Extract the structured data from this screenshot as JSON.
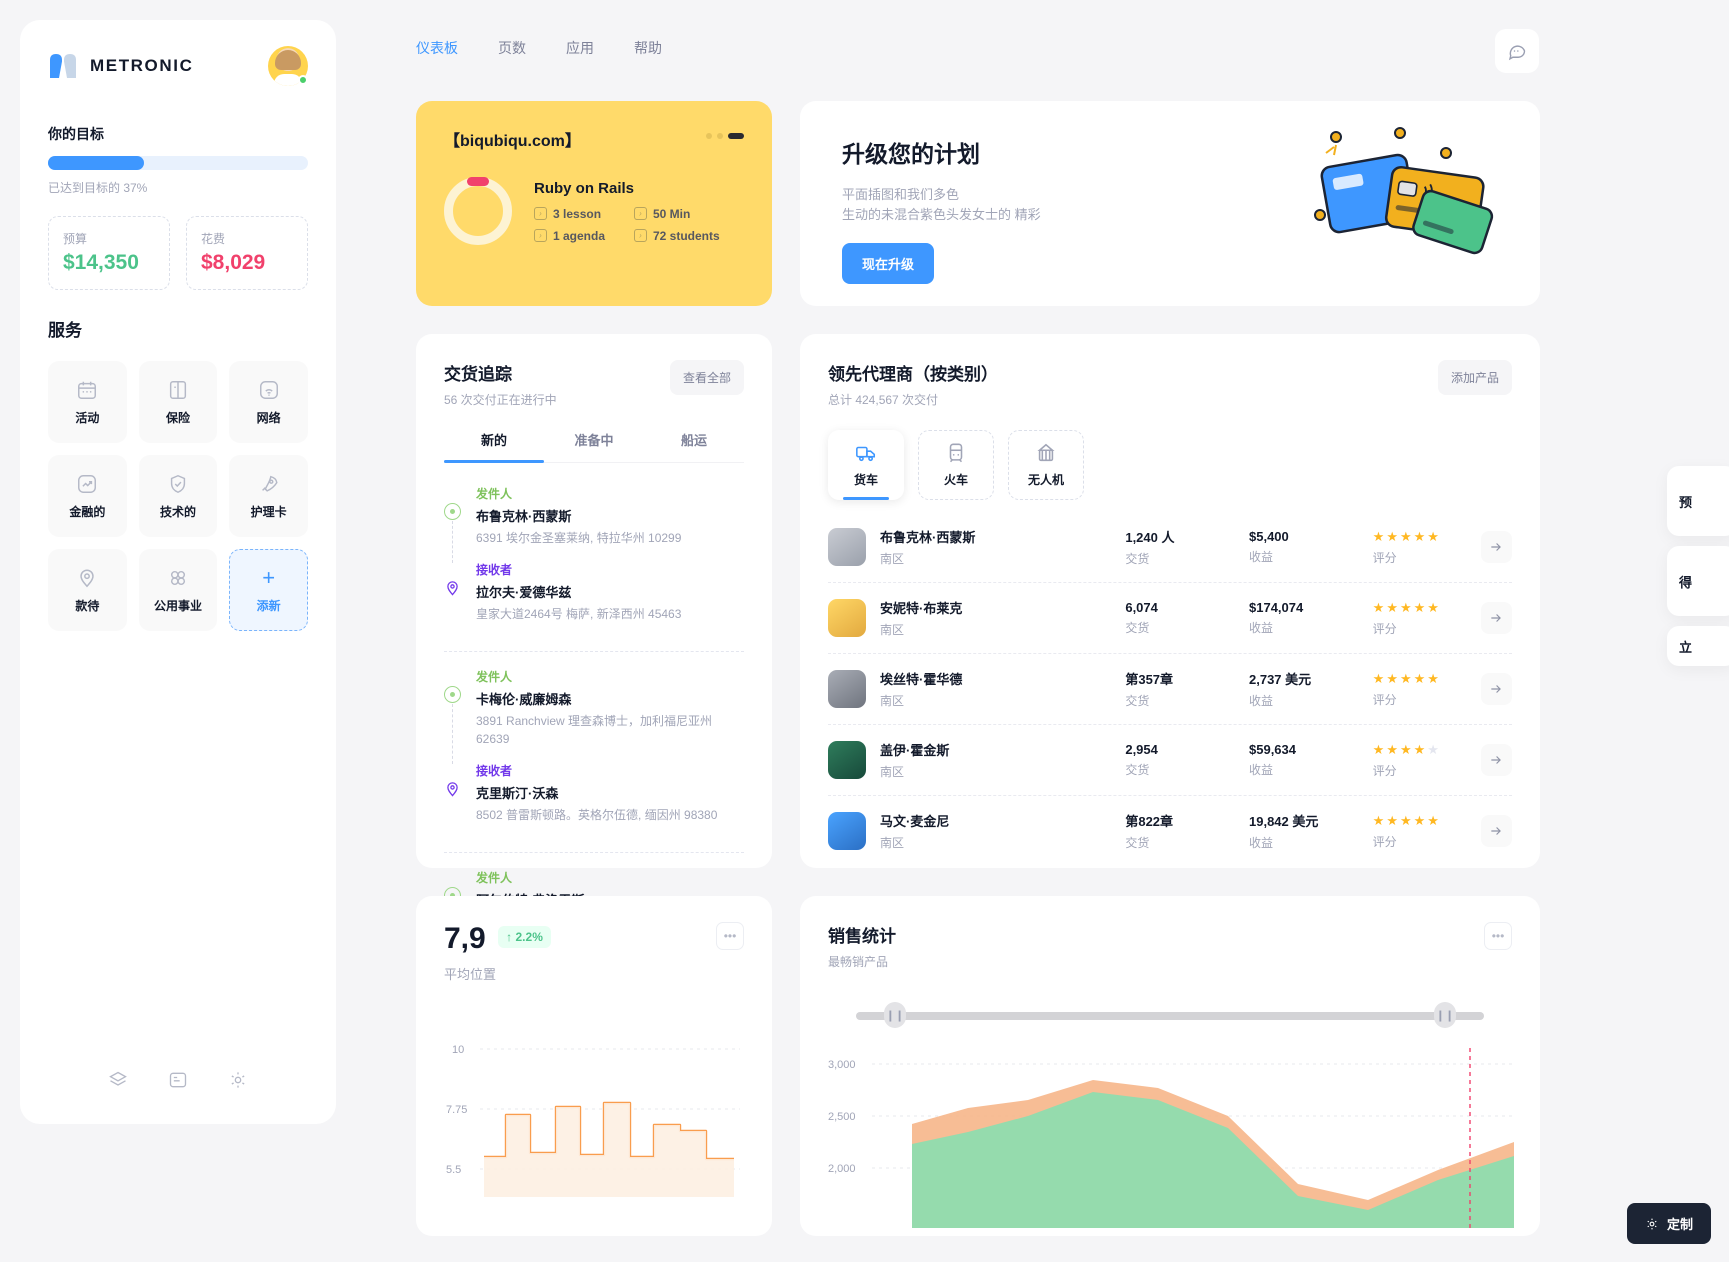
{
  "brand": {
    "name": "METRONIC"
  },
  "topnav": {
    "items": [
      {
        "label": "仪表板",
        "active": true
      },
      {
        "label": "页数",
        "active": false
      },
      {
        "label": "应用",
        "active": false
      },
      {
        "label": "帮助",
        "active": false
      }
    ]
  },
  "sidebar": {
    "goal_title": "你的目标",
    "progress_percent": 37,
    "progress_text": "已达到目标的 37%",
    "stats": [
      {
        "label": "预算",
        "value": "$14,350",
        "color": "#4cc38a"
      },
      {
        "label": "花费",
        "value": "$8,029",
        "color": "#f1416c"
      }
    ],
    "services_title": "服务",
    "services": [
      {
        "label": "活动",
        "icon": "calendar-icon"
      },
      {
        "label": "保险",
        "icon": "book-icon"
      },
      {
        "label": "网络",
        "icon": "wifi-icon"
      },
      {
        "label": "金融的",
        "icon": "chart-up-icon"
      },
      {
        "label": "技术的",
        "icon": "shield-check-icon"
      },
      {
        "label": "护理卡",
        "icon": "rocket-icon"
      },
      {
        "label": "款待",
        "icon": "location-pin-icon"
      },
      {
        "label": "公用事业",
        "icon": "grid-dots-icon"
      },
      {
        "label": "添新",
        "icon": "plus-icon",
        "add": true
      }
    ],
    "footer_icons": [
      "layers-icon",
      "note-icon",
      "gear-icon"
    ]
  },
  "promo_card": {
    "site": "【biqubiqu.com】",
    "course": "Ruby on Rails",
    "meta": [
      "3 lesson",
      "50 Min",
      "1 agenda",
      "72 students"
    ]
  },
  "upgrade": {
    "title": "升级您的计划",
    "desc_line1": "平面插图和我们多色",
    "desc_line2": "生动的未混合紫色头发女士的 精彩",
    "button": "现在升级"
  },
  "delivery": {
    "title": "交货追踪",
    "subtitle": "56 次交付正在进行中",
    "view_all": "查看全部",
    "tabs": [
      {
        "label": "新的",
        "active": true
      },
      {
        "label": "准备中",
        "active": false
      },
      {
        "label": "船运",
        "active": false
      }
    ],
    "label_sender": "发件人",
    "label_receiver": "接收者",
    "groups": [
      {
        "sender_name": "布鲁克林·西蒙斯",
        "sender_addr": "6391 埃尔金圣塞莱纳, 特拉华州 10299",
        "receiver_name": "拉尔夫·爱德华兹",
        "receiver_addr": "皇家大道2464号 梅萨, 新泽西州 45463"
      },
      {
        "sender_name": "卡梅伦·威廉姆森",
        "sender_addr": "3891 Ranchview 理查森博士，加利福尼亚州 62639",
        "receiver_name": "克里斯汀·沃森",
        "receiver_addr": "8502 普雷斯顿路。英格尔伍德, 缅因州 98380"
      },
      {
        "sender_name": "阿尔伯特·弗洛雷斯",
        "sender_addr": "",
        "receiver_name": "",
        "receiver_addr": ""
      }
    ]
  },
  "agents": {
    "title": "领先代理商（按类别）",
    "subtitle": "总计 424,567 次交付",
    "add_product": "添加产品",
    "categories": [
      {
        "label": "货车",
        "icon": "truck-icon",
        "active": true
      },
      {
        "label": "火车",
        "icon": "train-icon",
        "active": false
      },
      {
        "label": "无人机",
        "icon": "drone-icon",
        "active": false
      }
    ],
    "col_labels": {
      "deliveries": "交货",
      "revenue": "收益",
      "rating": "评分"
    },
    "rows": [
      {
        "name": "布鲁克林·西蒙斯",
        "region": "南区",
        "deliveries": "1,240 人",
        "revenue": "$5,400",
        "stars": 5,
        "avatar": "#b9bcc4"
      },
      {
        "name": "安妮特·布莱克",
        "region": "南区",
        "deliveries": "6,074",
        "revenue": "$174,074",
        "stars": 5,
        "avatar": "#f4c95d"
      },
      {
        "name": "埃丝特·霍华德",
        "region": "南区",
        "deliveries": "第357章",
        "revenue": "2,737 美元",
        "stars": 5,
        "avatar": "#8e8e93"
      },
      {
        "name": "盖伊·霍金斯",
        "region": "南区",
        "deliveries": "2,954",
        "revenue": "$59,634",
        "stars": 4,
        "avatar": "#2f7d5c"
      },
      {
        "name": "马文·麦金尼",
        "region": "南区",
        "deliveries": "第822章",
        "revenue": "19,842 美元",
        "stars": 5,
        "avatar": "#3e97ff"
      }
    ]
  },
  "avg_position": {
    "value": "7,9",
    "change": "↑ 2.2%",
    "label": "平均位置"
  },
  "sales": {
    "title": "销售统计",
    "subtitle": "最畅销产品"
  },
  "peek_cards": [
    {
      "text": "预"
    },
    {
      "text": "得"
    },
    {
      "text": "立"
    }
  ],
  "custom_button": {
    "label": "定制",
    "icon": "gear-icon"
  },
  "chart_data": [
    {
      "type": "area",
      "title": "平均位置",
      "ylabel": "",
      "xlabel": "",
      "ylim": [
        5.5,
        10
      ],
      "yticks": [
        10,
        7.75,
        5.5
      ],
      "ytick_labels": [
        "10",
        "7.75",
        "5.5"
      ],
      "grid": true,
      "series": [
        {
          "name": "position",
          "color": "#f99d4e",
          "values": [
            6.2,
            6.2,
            7.9,
            7.9,
            6.3,
            6.3,
            8.6,
            8.6,
            6.4,
            7.6,
            7.6
          ]
        }
      ]
    },
    {
      "type": "area",
      "title": "销售统计",
      "subtitle": "最畅销产品",
      "ylabel": "",
      "xlabel": "",
      "ylim": [
        2000,
        3000
      ],
      "yticks": [
        3000,
        2500,
        2000
      ],
      "ytick_labels": [
        "3,000",
        "2,500",
        "2,000"
      ],
      "grid": true,
      "series": [
        {
          "name": "series-a",
          "color": "#f4a261",
          "values": [
            2480,
            2560,
            2600,
            2700,
            2660,
            2520,
            2180,
            2100,
            2250,
            2400
          ]
        },
        {
          "name": "series-b",
          "color": "#7ed9a4",
          "values": [
            2380,
            2440,
            2520,
            2640,
            2600,
            2460,
            2120,
            2050,
            2200,
            2330
          ]
        }
      ]
    }
  ]
}
